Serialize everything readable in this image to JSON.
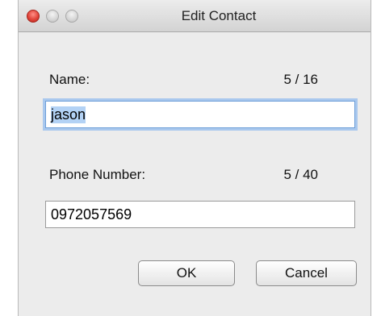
{
  "window": {
    "title": "Edit Contact"
  },
  "name_field": {
    "label": "Name:",
    "counter": "5 / 16",
    "value": "jason"
  },
  "phone_field": {
    "label": "Phone Number:",
    "counter": "5 / 40",
    "value": "0972057569"
  },
  "buttons": {
    "ok_label": "OK",
    "cancel_label": "Cancel"
  },
  "colors": {
    "close_button": "#e0443a",
    "focus_ring": "#a9c8ee",
    "selection": "#b3d2f5"
  }
}
